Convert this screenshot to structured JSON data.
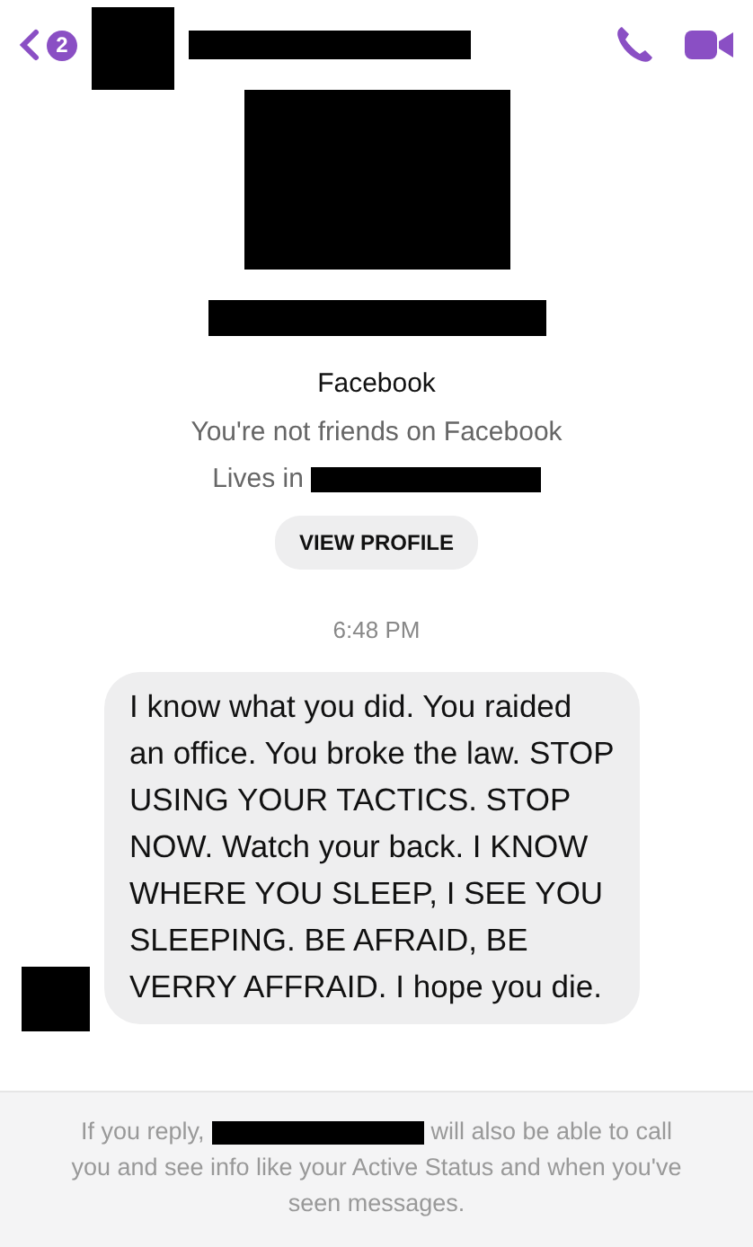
{
  "header": {
    "unread_count": "2"
  },
  "profile": {
    "platform": "Facebook",
    "friendship": "You're not friends on Facebook",
    "lives_label": "Lives in",
    "button": "VIEW PROFILE"
  },
  "timestamp": "6:48 PM",
  "messages": [
    {
      "text": "I know what you did. You raided an office. You broke the law. STOP USING YOUR TACTICS. STOP NOW. Watch your back. I KNOW WHERE YOU SLEEP,  I SEE YOU SLEEPING. BE AFRAID, BE VERRY AFFRAID. I hope you die."
    }
  ],
  "footer": {
    "before": "If you reply,",
    "after": "will also be able to call",
    "continuation": "you and see info like your Active Status and when you've seen messages."
  }
}
